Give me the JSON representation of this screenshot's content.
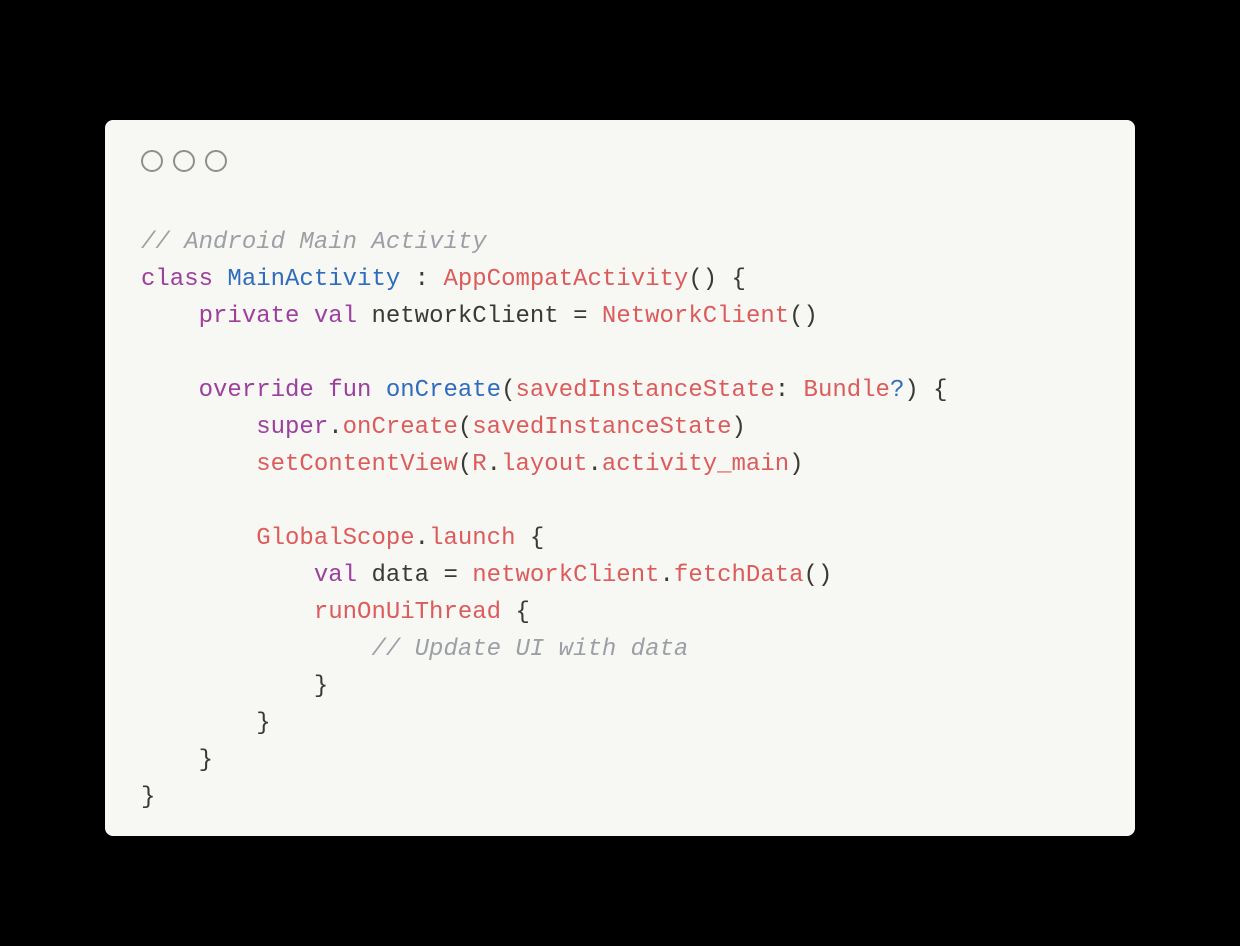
{
  "language": "kotlin",
  "colors": {
    "page_bg": "#000000",
    "window_bg": "#f7f7f4",
    "comment": "#9ca0a6",
    "keyword": "#9d3f9d",
    "classname": "#2f6cbd",
    "call": "#dc5b5b",
    "default": "#393a34",
    "dot_border": "#8f8f8f"
  },
  "traffic_lights": {
    "count": 3
  },
  "code": {
    "l1": {
      "comment": "// Android Main Activity"
    },
    "l2": {
      "kw_class": "class",
      "name": "MainActivity",
      "colon": " : ",
      "supertype": "AppCompatActivity",
      "after": "() {"
    },
    "l3": {
      "indent": "    ",
      "kw_private": "private",
      "kw_val": "val",
      "ident": "networkClient",
      "eq": " = ",
      "ctor": "NetworkClient",
      "after": "()"
    },
    "l4": {
      "blank": ""
    },
    "l5": {
      "indent": "    ",
      "kw_override": "override",
      "kw_fun": "fun",
      "fn": "onCreate",
      "lp": "(",
      "param": "savedInstanceState",
      "colon2": ": ",
      "ptype": "Bundle",
      "nullable": "?",
      "rp": ") {"
    },
    "l6": {
      "indent": "        ",
      "kw_super": "super",
      "dot": ".",
      "call": "onCreate",
      "lp": "(",
      "arg": "savedInstanceState",
      "rp": ")"
    },
    "l7": {
      "indent": "        ",
      "call": "setContentView",
      "lp": "(",
      "seg1": "R",
      "dot1": ".",
      "seg2": "layout",
      "dot2": ".",
      "seg3": "activity_main",
      "rp": ")"
    },
    "l8": {
      "blank": ""
    },
    "l9": {
      "indent": "        ",
      "recv": "GlobalScope",
      "dot": ".",
      "call": "launch",
      "sp": " ",
      "brace": "{"
    },
    "l10": {
      "indent": "            ",
      "kw_val": "val",
      "ident": "data",
      "eq": " = ",
      "recv": "networkClient",
      "dot": ".",
      "call": "fetchData",
      "after": "()"
    },
    "l11": {
      "indent": "            ",
      "call": "runOnUiThread",
      "sp": " ",
      "brace": "{"
    },
    "l12": {
      "indent": "                ",
      "comment": "// Update UI with data"
    },
    "l13": {
      "indent": "            ",
      "brace": "}"
    },
    "l14": {
      "indent": "        ",
      "brace": "}"
    },
    "l15": {
      "indent": "    ",
      "brace": "}"
    },
    "l16": {
      "brace": "}"
    }
  }
}
